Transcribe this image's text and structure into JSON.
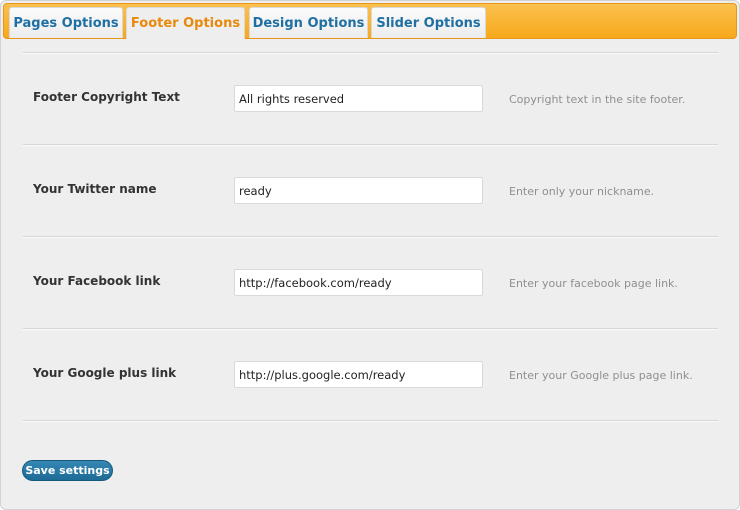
{
  "tabs": [
    {
      "label": "Pages Options",
      "active": false
    },
    {
      "label": "Footer Options",
      "active": true
    },
    {
      "label": "Design Options",
      "active": false
    },
    {
      "label": "Slider Options",
      "active": false
    }
  ],
  "fields": [
    {
      "label": "Footer Copyright Text",
      "value": "All rights reserved",
      "help": "Copyright text in the site footer."
    },
    {
      "label": "Your Twitter name",
      "value": "ready",
      "help": "Enter only your nickname."
    },
    {
      "label": "Your Facebook link",
      "value": "http://facebook.com/ready",
      "help": "Enter your facebook page link."
    },
    {
      "label": "Your Google plus link",
      "value": "http://plus.google.com/ready",
      "help": "Enter your Google plus page link."
    }
  ],
  "save_label": "Save settings",
  "colors": {
    "tabbar_accent": "#f7a91c",
    "active_tab_text": "#e8890c",
    "tab_text": "#1f6fa3",
    "button": "#1d6b96"
  }
}
